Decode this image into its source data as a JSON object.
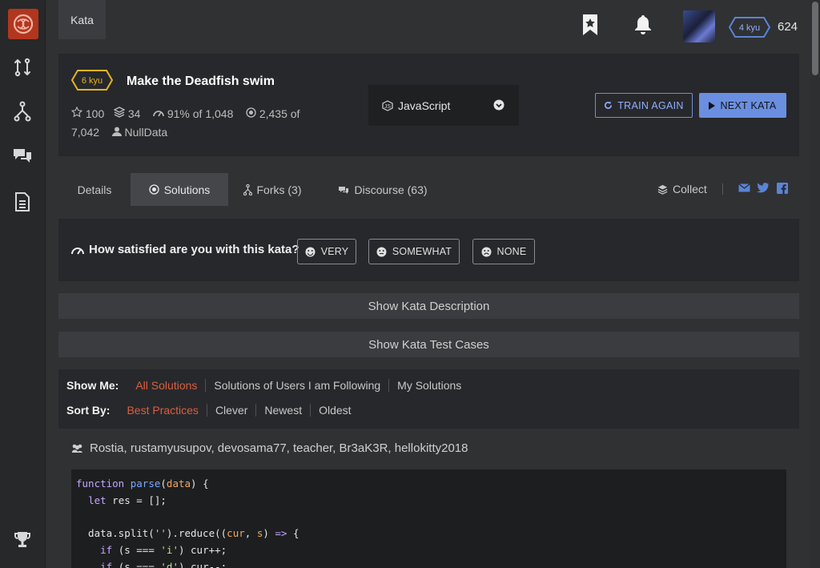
{
  "topbar": {
    "breadcrumb": "Kata",
    "rank": "4 kyu",
    "honor": "624"
  },
  "kata": {
    "rank": "6 kyu",
    "title": "Make the Deadfish swim",
    "stars": "100",
    "collections": "34",
    "satisfaction_pct": "91%",
    "satisfaction_of": "of 1,048",
    "completed": "2,435",
    "completed_of": "of",
    "attempts": "7,042",
    "author": "NullData",
    "language": "JavaScript",
    "train_again": "TRAIN AGAIN",
    "next_kata": "NEXT KATA"
  },
  "tabs": [
    {
      "label": "Details"
    },
    {
      "label": "Solutions"
    },
    {
      "label": "Forks (3)"
    },
    {
      "label": "Discourse (63)"
    }
  ],
  "collect_label": "Collect",
  "satisfaction": {
    "question": "How satisfied are you with this kata?",
    "very": "VERY",
    "somewhat": "SOMEWHAT",
    "none": "NONE"
  },
  "show_description": "Show Kata Description",
  "show_tests": "Show Kata Test Cases",
  "filters": {
    "show_label": "Show Me:",
    "show_options": [
      "All Solutions",
      "Solutions of Users I am Following",
      "My Solutions"
    ],
    "sort_label": "Sort By:",
    "sort_options": [
      "Best Practices",
      "Clever",
      "Newest",
      "Oldest"
    ]
  },
  "solution": {
    "authors": "Rostia, rustamyusupov, devosama77, teacher, Br3aK3R, hellokitty2018",
    "code_lines": [
      "function parse(data) {",
      "  let res = [];",
      "",
      "  data.split('').reduce((cur, s) => {",
      "    if (s === 'i') cur++;",
      "    if (s === 'd') cur--;"
    ]
  },
  "colors": {
    "accent_blue": "#6b8fe0",
    "kyu_yellow": "#e6b422",
    "rank_blue": "#5a84d6",
    "selected_orange": "#d95f40",
    "logo_red": "#b1361e"
  }
}
